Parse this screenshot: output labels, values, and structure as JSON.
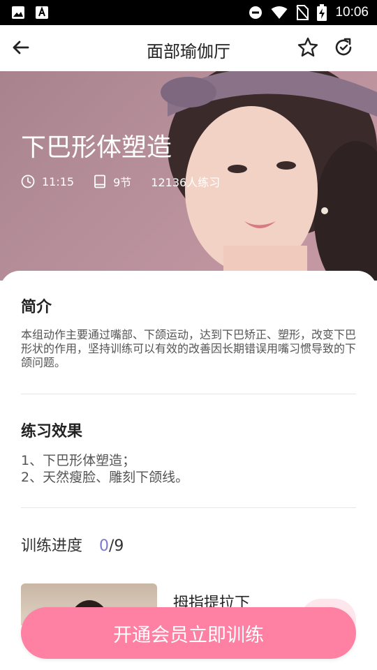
{
  "status_bar": {
    "time": "10:06",
    "icons": [
      "image-icon",
      "font-icon",
      "do-not-disturb-icon",
      "wifi-icon",
      "no-sim-icon",
      "battery-charging-icon"
    ]
  },
  "app_bar": {
    "title": "面部瑜伽厅",
    "icons": [
      "back-arrow-icon",
      "star-icon",
      "refresh-icon"
    ]
  },
  "hero": {
    "title": "下巴形体塑造",
    "duration": "11:15",
    "sections": "9节",
    "practitioners": "12136人练习",
    "icons": [
      "clock-icon",
      "book-icon"
    ]
  },
  "intro": {
    "heading": "简介",
    "text": "本组动作主要通过嘴部、下颌运动，达到下巴矫正、塑形，改变下巴形状的作用，坚持训练可以有效的改善因长期错误用嘴习惯导致的下颌问题。"
  },
  "effects": {
    "heading": "练习效果",
    "line1": "1、下巴形体塑造；",
    "line2": "2、天然瘦脸、雕刻下颌线。"
  },
  "progress": {
    "label": "训练进度",
    "current": "0",
    "total": "/9"
  },
  "first_lesson": {
    "title": "拇指提拉下"
  },
  "cta": {
    "label": "开通会员立即训练"
  },
  "colors": {
    "accent": "#fe80a2",
    "progress_current": "#7b79cf",
    "hero_bg": "#b58e99"
  }
}
